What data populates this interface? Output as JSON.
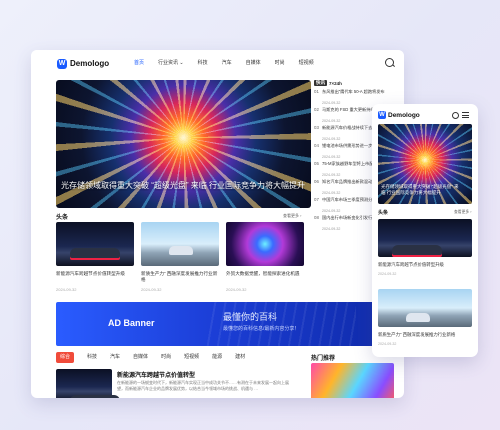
{
  "desktop": {
    "logo": {
      "mark": "W",
      "text": "Demologo"
    },
    "nav": [
      "首页",
      "行业资讯 ⌄",
      "科技",
      "汽车",
      "自媒体",
      "时尚",
      "短视频"
    ],
    "hero_caption": "光存储领域取得重大突破 “超级光盘” 来临 行业国际竞争力将大幅提升",
    "section_headline": "头条",
    "more_label": "查看更多 ›",
    "cards": [
      {
        "title": "新能源汽车跨越节点价值转型升级",
        "date": "2024-09-32"
      },
      {
        "title": "新质生产力” 西融深度发展推力行业新格",
        "date": "2024-09-32"
      },
      {
        "title": "外贸大数据觉醒，智能探索进化机遇",
        "date": "2024-09-32"
      }
    ],
    "banner": {
      "label": "AD Banner",
      "line1": "最懂你的百科",
      "line2": "最懂您的百科信息/最新内容分享！"
    },
    "tabs": [
      "综合",
      "科技",
      "汽车",
      "自媒体",
      "时尚",
      "短视频",
      "能源",
      "建材"
    ],
    "news": {
      "title": "新能源汽车跨越节点价值转型",
      "desc": "在新能源的一场蜕变时代下，新能源汽车实现正当中成功关节不……有测在于未来发展一起向上展望，而新能源汽车企业的品牌发展优势，以结合当今领域市场的挑战、机遇与 …"
    },
    "sidebar": {
      "tag": "快讯",
      "head": "7×24h",
      "items": [
        {
          "n": "01",
          "title": "东风推出“鹰代车 50-A 超跑将发布",
          "date": "2024-09-32"
        },
        {
          "n": "02",
          "title": "马斯克的 FSD 重大更新持续推进中",
          "date": "2024-09-32"
        },
        {
          "n": "03",
          "title": "新能源汽车价格战持续下去值得思考",
          "date": "2024-09-32"
        },
        {
          "n": "04",
          "title": "锂电池市场供需形势进一步变化中",
          "date": "2024-09-32"
        },
        {
          "n": "05",
          "title": "75-M家族越野车型将上市配置曝光",
          "date": "2024-09-32"
        },
        {
          "n": "06",
          "title": "知名汽车品牌推出新款混动车型",
          "date": "2024-09-32"
        },
        {
          "n": "07",
          "title": "中国汽车市场三季度预测分析报告",
          "date": "2024-09-32"
        },
        {
          "n": "08",
          "title": "国内出行市场新变化引发行业关注",
          "date": "2024-09-32"
        }
      ]
    },
    "hot_title": "热门推荐"
  },
  "mobile": {
    "logo": {
      "mark": "W",
      "text": "Demologo"
    },
    "hero_caption": "光存储领域取得重大突破 “超级光盘” 来临 行业国际竞争力将大幅提升",
    "section": "头条",
    "more_label": "查看更多 ›",
    "cards": [
      {
        "title": "新能源汽车跨越节点价值转型升级",
        "date": "2024-09-32"
      },
      {
        "title": "新质生产力” 西融深度发展推力行业新格",
        "date": "2024-09-32"
      }
    ]
  }
}
